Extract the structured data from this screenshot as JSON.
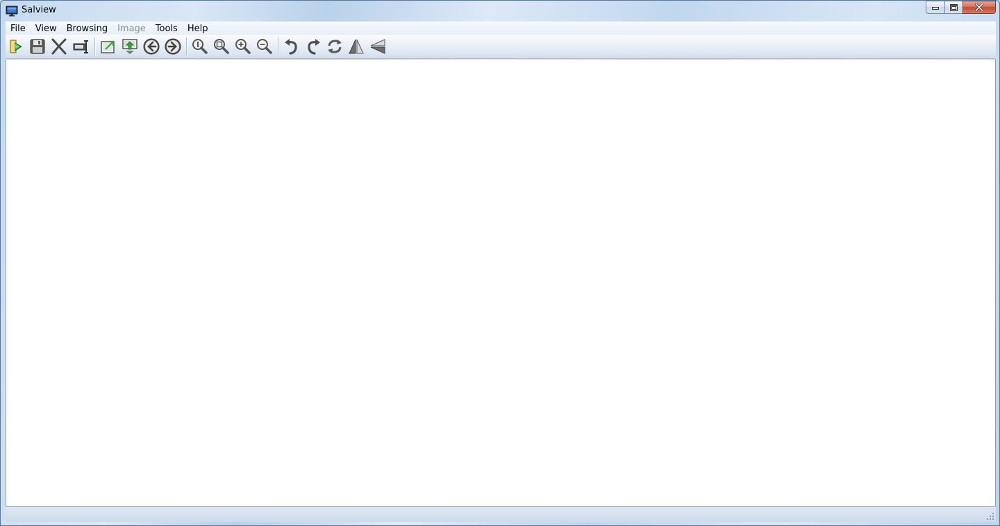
{
  "window": {
    "title": "Salview",
    "app_icon": "monitor-icon",
    "caption": {
      "minimize": "minimize-icon",
      "maximize": "maximize-icon",
      "close": "close-icon"
    }
  },
  "menu": [
    {
      "label": "File",
      "enabled": true
    },
    {
      "label": "View",
      "enabled": true
    },
    {
      "label": "Browsing",
      "enabled": true
    },
    {
      "label": "Image",
      "enabled": false
    },
    {
      "label": "Tools",
      "enabled": true
    },
    {
      "label": "Help",
      "enabled": true
    }
  ],
  "toolbar": {
    "groups": [
      [
        "open-folder-icon",
        "save-icon",
        "delete-icon",
        "rename-icon"
      ],
      [
        "export-icon",
        "set-wallpaper-icon",
        "previous-icon",
        "next-icon"
      ],
      [
        "actual-size-icon",
        "fit-window-icon",
        "zoom-in-icon",
        "zoom-out-icon"
      ],
      [
        "rotate-left-icon",
        "rotate-right-icon",
        "auto-rotate-icon",
        "flip-horizontal-icon",
        "flip-vertical-icon"
      ]
    ]
  },
  "colors": {
    "title_bar": "#c6daef",
    "close_button": "#c24a35",
    "toolbar_icon_gray": "#6d6d6d",
    "toolbar_icon_green": "#3aa33a",
    "content_background": "#ffffff"
  }
}
